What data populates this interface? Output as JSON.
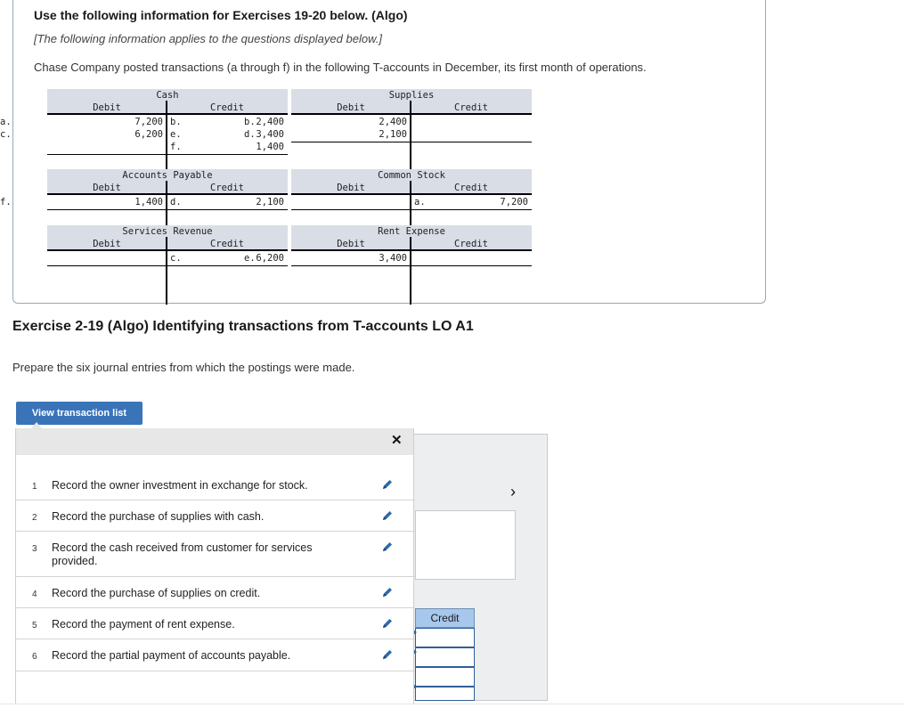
{
  "info": {
    "title": "Use the following information for Exercises 19-20 below. (Algo)",
    "subtitle": "[The following information applies to the questions displayed below.]",
    "text": "Chase Company posted transactions (a through f) in the following T-accounts in December, its first month of operations."
  },
  "taccounts": [
    {
      "name": "Cash",
      "debit_label": "Debit",
      "credit_label": "Credit",
      "debit_letters": "a.\nc.",
      "debit_amounts": "7,200\n6,200",
      "credit_letters": "b.\ne.\nf.",
      "credit_amounts": "2,400\n3,400\n1,400"
    },
    {
      "name": "Supplies",
      "debit_label": "Debit",
      "credit_label": "Credit",
      "debit_letters": "b.\nd.",
      "debit_amounts": "2,400\n2,100",
      "credit_letters": "",
      "credit_amounts": ""
    },
    {
      "name": "Accounts Payable",
      "debit_label": "Debit",
      "credit_label": "Credit",
      "debit_letters": "f.",
      "debit_amounts": "1,400",
      "credit_letters": "d.",
      "credit_amounts": "2,100"
    },
    {
      "name": "Common Stock",
      "debit_label": "Debit",
      "credit_label": "Credit",
      "debit_letters": "",
      "debit_amounts": "",
      "credit_letters": "a.",
      "credit_amounts": "7,200"
    },
    {
      "name": "Services Revenue",
      "debit_label": "Debit",
      "credit_label": "Credit",
      "debit_letters": "",
      "debit_amounts": "",
      "credit_letters": "c.",
      "credit_amounts": "6,200"
    },
    {
      "name": "Rent Expense",
      "debit_label": "Debit",
      "credit_label": "Credit",
      "debit_letters": "e.",
      "debit_amounts": "3,400",
      "credit_letters": "",
      "credit_amounts": ""
    }
  ],
  "exercise": {
    "title": "Exercise 2-19 (Algo) Identifying transactions from T-accounts LO A1",
    "prompt": "Prepare the six journal entries from which the postings were made.",
    "view_button": "View transaction list"
  },
  "transactions": [
    {
      "num": "1",
      "text": "Record the owner investment in exchange for stock."
    },
    {
      "num": "2",
      "text": "Record the purchase of supplies with cash."
    },
    {
      "num": "3",
      "text": "Record the cash received from customer for services provided."
    },
    {
      "num": "4",
      "text": "Record the purchase of supplies on credit."
    },
    {
      "num": "5",
      "text": "Record the payment of rent expense."
    },
    {
      "num": "6",
      "text": "Record the partial payment of accounts payable."
    }
  ],
  "panel": {
    "close_glyph": "✕",
    "next_glyph": "›",
    "credit_header": "Credit"
  },
  "colors": {
    "accent": "#3a74b8",
    "header_gray": "#d9dde6",
    "credit_blue": "#a7c7ec"
  }
}
